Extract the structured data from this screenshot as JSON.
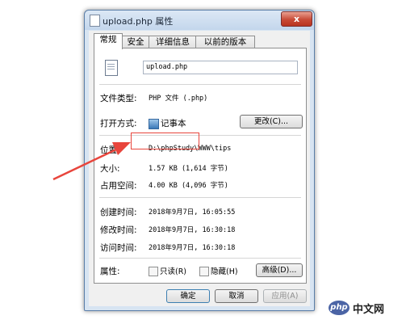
{
  "window": {
    "title": "upload.php 属性",
    "close_label": "x"
  },
  "tabs": [
    {
      "label": "常规"
    },
    {
      "label": "安全"
    },
    {
      "label": "详细信息"
    },
    {
      "label": "以前的版本"
    }
  ],
  "general": {
    "filename": "upload.php",
    "file_type_label": "文件类型:",
    "file_type_value": "PHP 文件 (.php)",
    "opens_with_label": "打开方式:",
    "opens_with_value": "记事本",
    "change_button": "更改(C)...",
    "location_label": "位置:",
    "location_value": "D:\\phpStudy\\WWW\\tips",
    "size_label": "大小:",
    "size_value": "1.57 KB (1,614 字节)",
    "size_on_disk_label": "占用空间:",
    "size_on_disk_value": "4.00 KB (4,096 字节)",
    "created_label": "创建时间:",
    "created_value": "2018年9月7日, 16:05:55",
    "modified_label": "修改时间:",
    "modified_value": "2018年9月7日, 16:30:18",
    "accessed_label": "访问时间:",
    "accessed_value": "2018年9月7日, 16:30:18",
    "attributes_label": "属性:",
    "readonly_label": "只读(R)",
    "hidden_label": "隐藏(H)",
    "advanced_button": "高级(D)..."
  },
  "footer": {
    "ok": "确定",
    "cancel": "取消",
    "apply": "应用(A)"
  },
  "brand": {
    "logo": "php",
    "text": "中文网"
  },
  "colors": {
    "annotation": "#e8453c",
    "window_frame": "#d7e4f2",
    "close_button": "#c84a36"
  }
}
